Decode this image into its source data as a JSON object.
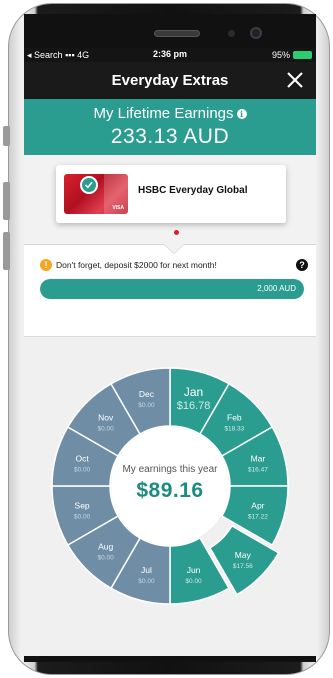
{
  "status_bar": {
    "back_label": "◂ Search",
    "signal": "4G",
    "time": "2:36 pm",
    "battery": "95%"
  },
  "nav": {
    "title": "Everyday Extras",
    "close_icon": "close-icon"
  },
  "earnings": {
    "label": "My Lifetime Earnings",
    "value": "233.13 AUD",
    "info_icon": "info-icon"
  },
  "card": {
    "name": "HSBC Everyday Global",
    "brand_mark": "VISA",
    "selected": true
  },
  "reminder": {
    "text": "Don't forget, deposit $2000 for next month!",
    "progress_label": "2,000 AUD",
    "progress_fraction": 1.0,
    "warning_icon": "warning-icon",
    "help_icon": "help-icon"
  },
  "wheel": {
    "caption": "My earnings this year",
    "total": "$89.16",
    "months": [
      {
        "label": "Jan",
        "value": "$16.78",
        "active": true
      },
      {
        "label": "Feb",
        "value": "$18.33",
        "active": true
      },
      {
        "label": "Mar",
        "value": "$16.47",
        "active": true
      },
      {
        "label": "Apr",
        "value": "$17.22",
        "active": true
      },
      {
        "label": "May",
        "value": "$17.56",
        "active": true,
        "highlighted": true
      },
      {
        "label": "Jun",
        "value": "$0.00",
        "active": true
      },
      {
        "label": "Jul",
        "value": "$0.00",
        "active": false
      },
      {
        "label": "Aug",
        "value": "$0.00",
        "active": false
      },
      {
        "label": "Sep",
        "value": "$0.00",
        "active": false
      },
      {
        "label": "Oct",
        "value": "$0.00",
        "active": false
      },
      {
        "label": "Nov",
        "value": "$0.00",
        "active": false
      },
      {
        "label": "Dec",
        "value": "$0.00",
        "active": false
      }
    ]
  },
  "colors": {
    "teal": "#2a9d90",
    "teal_dark": "#1f8a80",
    "slate": "#6f8ea6",
    "nav_bg": "#1a1a1a",
    "warning": "#f5a623"
  }
}
